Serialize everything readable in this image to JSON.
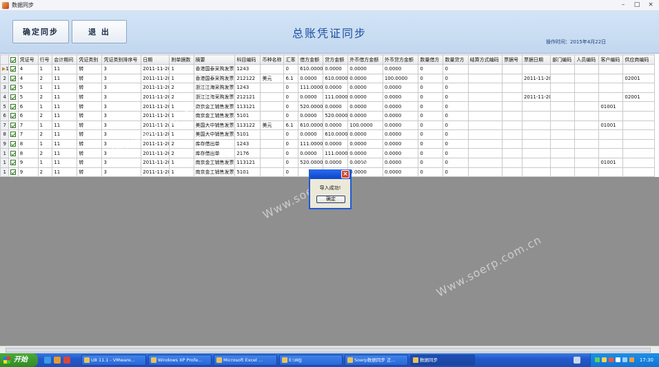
{
  "window": {
    "title": "数据同步"
  },
  "header": {
    "sync_button": "确定同步",
    "exit_button": "退  出",
    "title": "总账凭证同步",
    "operation_time": "操作时间：2015年4月22日"
  },
  "grid": {
    "columns": [
      "凭证号",
      "行号",
      "会计期间",
      "凭证类别",
      "凭证类别排序号",
      "日期",
      "附单据数",
      "摘要",
      "科目编码",
      "币种名称",
      "汇率",
      "借方金额",
      "贷方金额",
      "外币借方金额",
      "外币贷方金额",
      "数量借方",
      "数量贷方",
      "结算方式编码",
      "票据号",
      "票据日期",
      "部门编码",
      "人员编码",
      "客户编码",
      "供应商编码"
    ],
    "rows": [
      {
        "rn": "1",
        "v": [
          "4",
          "1",
          "11",
          "转",
          "3",
          "2011-11-20",
          "1",
          "香港国泰采购发票",
          "1243",
          "",
          "0",
          "610.0000",
          "0.0000",
          "0.0000",
          "0.0000",
          "0",
          "0",
          "",
          "",
          "",
          "",
          "",
          "",
          ""
        ]
      },
      {
        "rn": "2",
        "v": [
          "4",
          "2",
          "11",
          "转",
          "3",
          "2011-11-20",
          "1",
          "香港国泰采购发票",
          "212122",
          "美元",
          "6.1",
          "0.0000",
          "610.0000",
          "0.0000",
          "100.0000",
          "0",
          "0",
          "",
          "",
          "2011-11-20",
          "",
          "",
          "",
          "02001"
        ]
      },
      {
        "rn": "3",
        "v": [
          "5",
          "1",
          "11",
          "转",
          "3",
          "2011-11-20",
          "2",
          "浙江江海采购发票",
          "1243",
          "",
          "0",
          "111.0000",
          "0.0000",
          "0.0000",
          "0.0000",
          "0",
          "0",
          "",
          "",
          "",
          "",
          "",
          "",
          ""
        ]
      },
      {
        "rn": "4",
        "v": [
          "5",
          "2",
          "11",
          "转",
          "3",
          "2011-11-20",
          "2",
          "浙江江海采购发票",
          "212121",
          "",
          "0",
          "0.0000",
          "111.0000",
          "0.0000",
          "0.0000",
          "0",
          "0",
          "",
          "",
          "2011-11-20",
          "",
          "",
          "",
          "02001"
        ]
      },
      {
        "rn": "5",
        "v": [
          "6",
          "1",
          "11",
          "转",
          "3",
          "2011-11-20",
          "1",
          "南京金工销售发票",
          "113121",
          "",
          "0",
          "520.0000",
          "0.0000",
          "0.0000",
          "0.0000",
          "0",
          "0",
          "",
          "",
          "",
          "",
          "",
          "01001",
          ""
        ]
      },
      {
        "rn": "6",
        "v": [
          "6",
          "2",
          "11",
          "转",
          "3",
          "2011-11-20",
          "1",
          "南京金工销售发票",
          "5101",
          "",
          "0",
          "0.0000",
          "520.0000",
          "0.0000",
          "0.0000",
          "0",
          "0",
          "",
          "",
          "",
          "",
          "",
          "",
          ""
        ]
      },
      {
        "rn": "7",
        "v": [
          "7",
          "1",
          "11",
          "转",
          "3",
          "2011-11-20",
          "1",
          "美国大中销售发票",
          "113122",
          "美元",
          "6.1",
          "610.0000",
          "0.0000",
          "100.0000",
          "0.0000",
          "0",
          "0",
          "",
          "",
          "",
          "",
          "",
          "01001",
          ""
        ]
      },
      {
        "rn": "8",
        "v": [
          "7",
          "2",
          "11",
          "转",
          "3",
          "2011-11-20",
          "1",
          "美国大中销售发票",
          "5101",
          "",
          "0",
          "0.0000",
          "610.0000",
          "0.0000",
          "0.0000",
          "0",
          "0",
          "",
          "",
          "",
          "",
          "",
          "",
          ""
        ]
      },
      {
        "rn": "9",
        "v": [
          "8",
          "1",
          "11",
          "转",
          "3",
          "2011-11-20",
          "2",
          "库存借出单",
          "1243",
          "",
          "0",
          "111.0000",
          "0.0000",
          "0.0000",
          "0.0000",
          "0",
          "0",
          "",
          "",
          "",
          "",
          "",
          "",
          ""
        ]
      },
      {
        "rn": "1",
        "v": [
          "8",
          "2",
          "11",
          "转",
          "3",
          "2011-11-20",
          "2",
          "库存借出单",
          "2176",
          "",
          "0",
          "0.0000",
          "111.0000",
          "0.0000",
          "0.0000",
          "0",
          "0",
          "",
          "",
          "",
          "",
          "",
          "",
          ""
        ]
      },
      {
        "rn": "1",
        "v": [
          "9",
          "1",
          "11",
          "转",
          "3",
          "2011-11-20",
          "1",
          "南京金工销售发票",
          "113121",
          "",
          "0",
          "520.0000",
          "0.0000",
          "0.0000",
          "0.0000",
          "0",
          "0",
          "",
          "",
          "",
          "",
          "",
          "01001",
          ""
        ]
      },
      {
        "rn": "1",
        "v": [
          "9",
          "2",
          "11",
          "转",
          "3",
          "2011-11-20",
          "1",
          "南京金工销售发票",
          "5101",
          "",
          "0",
          "",
          "",
          "0.0000",
          "0.0000",
          "0",
          "0",
          "",
          "",
          "",
          "",
          "",
          "",
          ""
        ]
      }
    ]
  },
  "dialog": {
    "message": "导入成功!",
    "ok_button": "确定"
  },
  "watermarks": [
    "Www.soerp.com.cn",
    "Www.soerp.com.cn",
    "Www.soerp.com.cn"
  ],
  "taskbar": {
    "start_label": "开始",
    "tasks": [
      "U8 11.1 - VMware...",
      "Windows XP Profe...",
      "Microsoft Excel ...",
      "E:\\WJJ",
      "Soerp数据同步 正...",
      "数据同步"
    ],
    "clock": "17:30"
  }
}
